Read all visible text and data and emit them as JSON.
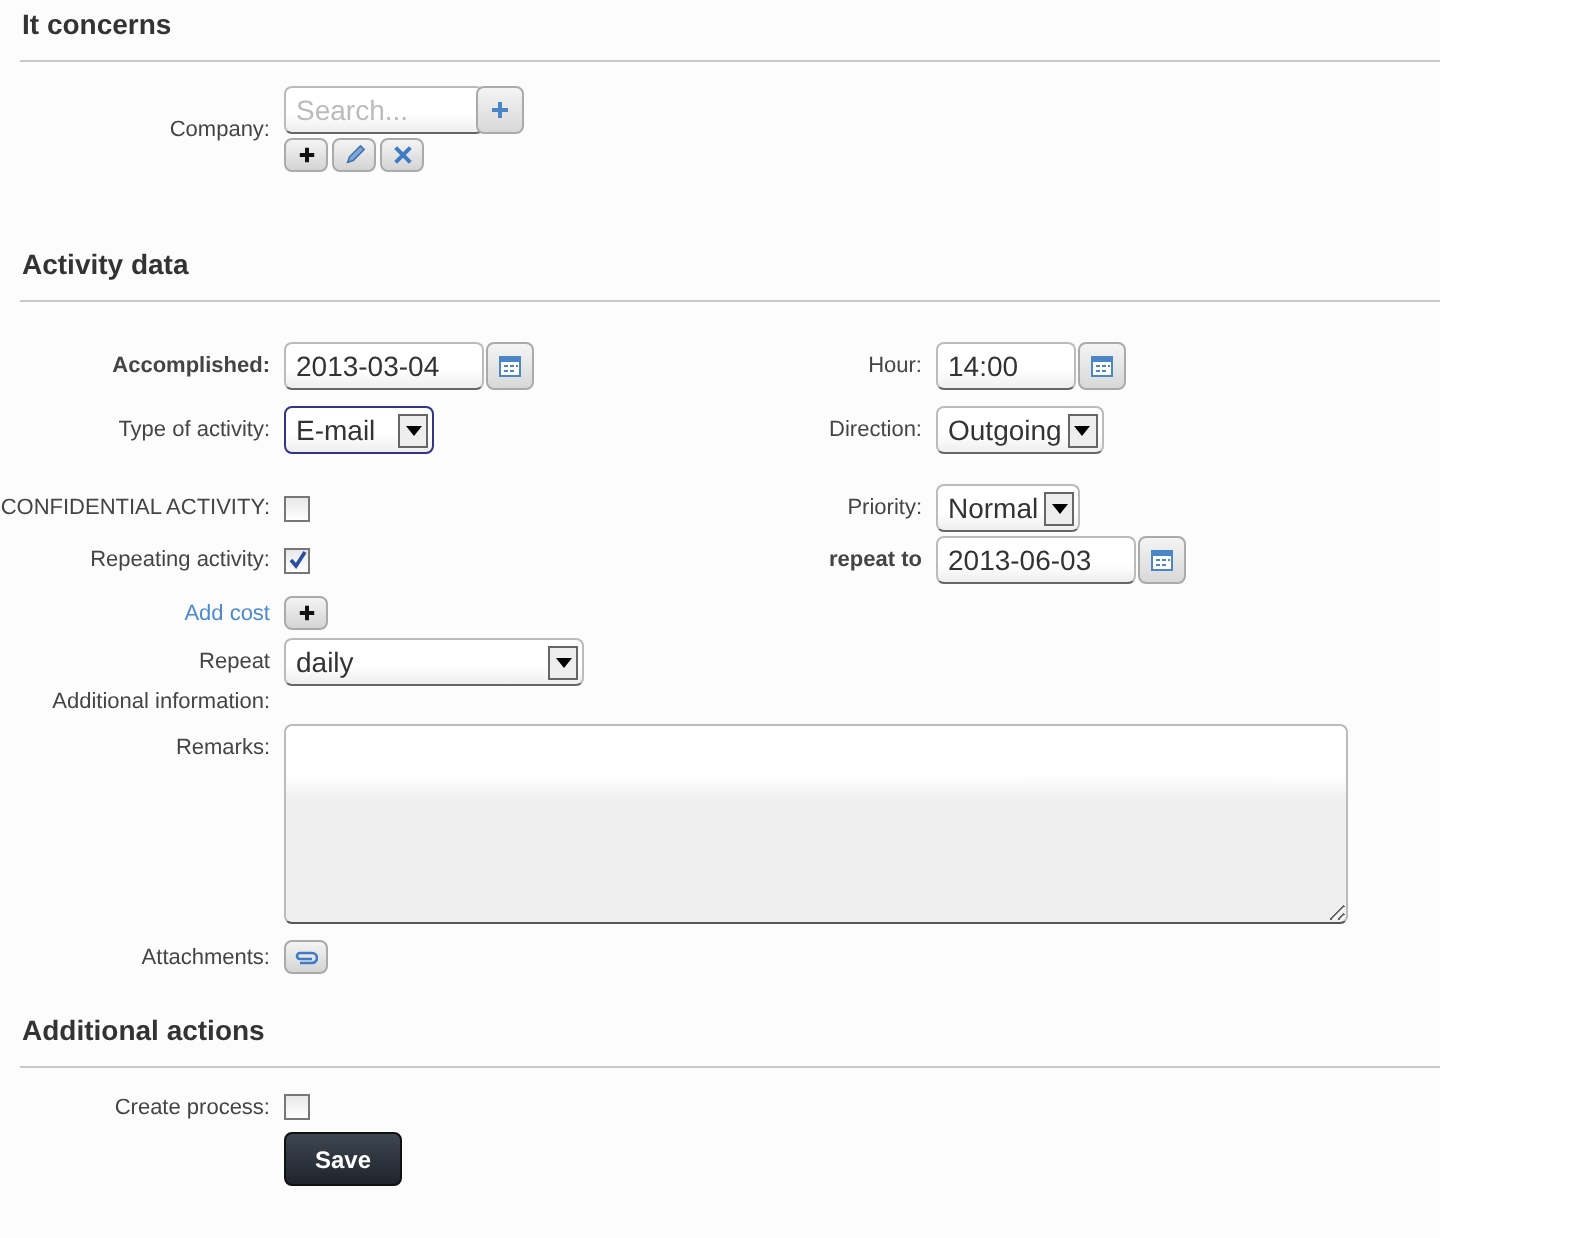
{
  "it_concerns": {
    "title": "It concerns",
    "company": {
      "label": "Company:",
      "placeholder": "Search..."
    }
  },
  "activity_data": {
    "title": "Activity data",
    "accomplished": {
      "label": "Accomplished:",
      "value": "2013-03-04",
      "required": true
    },
    "hour": {
      "label": "Hour:",
      "value": "14:00",
      "required": false
    },
    "type_of_activity": {
      "label": "Type of activity:",
      "value": "E-mail",
      "focused": true
    },
    "direction": {
      "label": "Direction:",
      "value": "Outgoing",
      "focused": false
    },
    "confidential": {
      "label": "CONFIDENTIAL ACTIVITY:",
      "checked": false
    },
    "priority": {
      "label": "Priority:",
      "value": "Normal",
      "focused": false
    },
    "repeating": {
      "label": "Repeating activity:",
      "checked": true
    },
    "repeat_to": {
      "label": "repeat to",
      "value": "2013-06-03",
      "required": true
    },
    "add_cost": {
      "label": "Add cost"
    },
    "repeat": {
      "label": "Repeat",
      "value": "daily",
      "focused": false
    },
    "additional_information": {
      "label": "Additional information:"
    },
    "remarks": {
      "label": "Remarks:"
    },
    "attachments": {
      "label": "Attachments:"
    }
  },
  "additional_actions": {
    "title": "Additional actions",
    "create_process": {
      "label": "Create process:",
      "checked": false
    },
    "save_button": "Save"
  }
}
